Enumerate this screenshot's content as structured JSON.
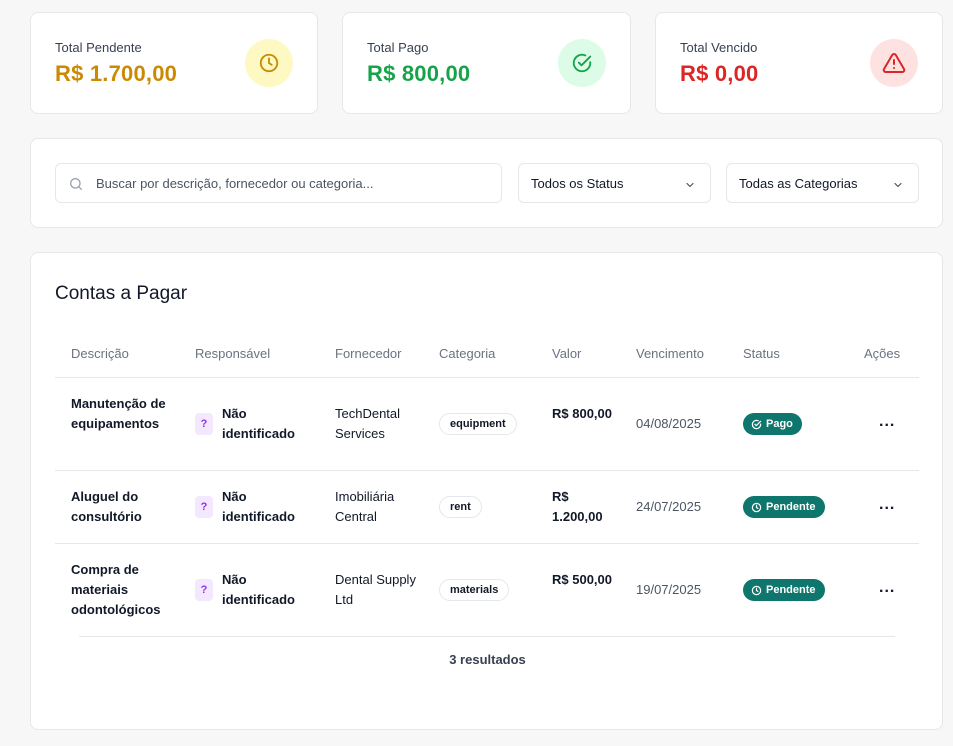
{
  "summary": {
    "pending": {
      "label": "Total Pendente",
      "value": "R$ 1.700,00",
      "color": "#ca8a04",
      "bg": "#fef9c3",
      "icon": "clock-icon"
    },
    "paid": {
      "label": "Total Pago",
      "value": "R$ 800,00",
      "color": "#16a34a",
      "bg": "#dcfce7",
      "icon": "check-circle-icon"
    },
    "overdue": {
      "label": "Total Vencido",
      "value": "R$ 0,00",
      "color": "#dc2626",
      "bg": "#fee2e2",
      "icon": "warning-triangle-icon"
    }
  },
  "filters": {
    "search_placeholder": "Buscar por descrição, fornecedor ou categoria...",
    "status_selected": "Todos os Status",
    "category_selected": "Todas as Categorias"
  },
  "table": {
    "title": "Contas a Pagar",
    "headers": {
      "description": "Descrição",
      "responsible": "Responsável",
      "supplier": "Fornecedor",
      "category": "Categoria",
      "value": "Valor",
      "due": "Vencimento",
      "status": "Status",
      "actions": "Ações"
    },
    "rows": [
      {
        "description": "Manutenção de equipamentos",
        "responsible_badge": "?",
        "responsible": "Não identificado",
        "supplier": "TechDental Services",
        "category": "equipment",
        "value": "R$ 800,00",
        "due": "04/08/2025",
        "status": "Pago",
        "status_icon": "check-circle-icon",
        "actions": "..."
      },
      {
        "description": "Aluguel do consultório",
        "responsible_badge": "?",
        "responsible": "Não identificado",
        "supplier": "Imobiliária Central",
        "category": "rent",
        "value": "R$ 1.200,00",
        "due": "24/07/2025",
        "status": "Pendente",
        "status_icon": "clock-icon",
        "actions": "..."
      },
      {
        "description": "Compra de materiais odontológicos",
        "responsible_badge": "?",
        "responsible": "Não identificado",
        "supplier": "Dental Supply Ltd",
        "category": "materials",
        "value": "R$ 500,00",
        "due": "19/07/2025",
        "status": "Pendente",
        "status_icon": "clock-icon",
        "actions": "..."
      }
    ],
    "footer": "3 resultados"
  },
  "colors": {
    "status_badge": "#0f766e",
    "border": "#e5e7eb"
  }
}
